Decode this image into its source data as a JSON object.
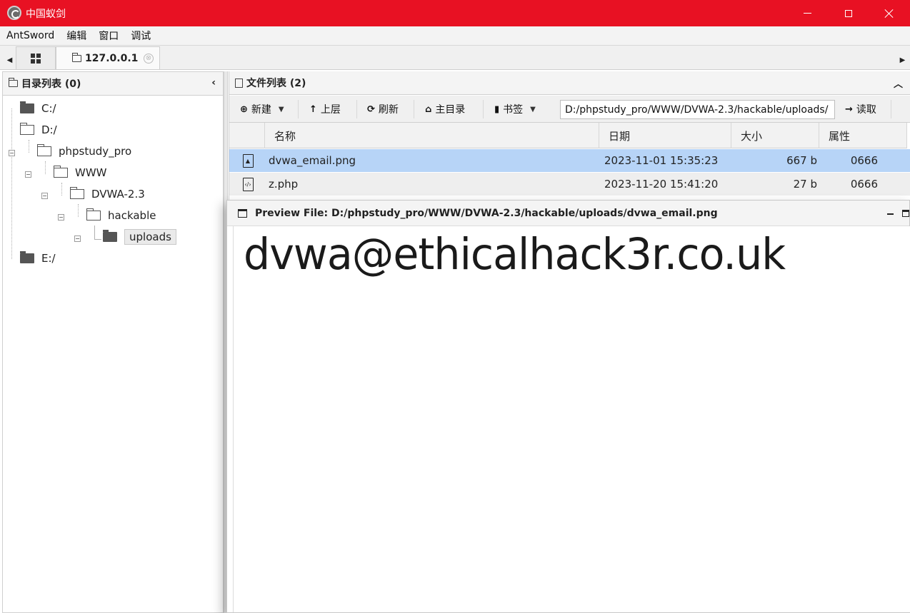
{
  "window": {
    "title": "中国蚁剑"
  },
  "menu": {
    "items": [
      "AntSword",
      "编辑",
      "窗口",
      "调试"
    ]
  },
  "tabs": {
    "host": "127.0.0.1",
    "close_glyph": "⊗"
  },
  "left_panel": {
    "title": "目录列表 (0)",
    "tree": [
      {
        "label": "C:/"
      },
      {
        "label": "D:/"
      },
      {
        "label": "phpstudy_pro"
      },
      {
        "label": "WWW"
      },
      {
        "label": "DVWA-2.3"
      },
      {
        "label": "hackable"
      },
      {
        "label": "uploads"
      },
      {
        "label": "E:/"
      }
    ]
  },
  "right_panel": {
    "title": "文件列表 (2)",
    "toolbar": {
      "new": "新建",
      "up": "上层",
      "refresh": "刷新",
      "home": "主目录",
      "bookmark": "书签",
      "path": "D:/phpstudy_pro/WWW/DVWA-2.3/hackable/uploads/",
      "read": "读取"
    },
    "columns": [
      "名称",
      "日期",
      "大小",
      "属性"
    ],
    "files": [
      {
        "name": "dvwa_email.png",
        "date": "2023-11-01 15:35:23",
        "size": "667 b",
        "attr": "0666",
        "icon": "image-file-icon"
      },
      {
        "name": "z.php",
        "date": "2023-11-20 15:41:20",
        "size": "27 b",
        "attr": "0666",
        "icon": "code-file-icon"
      }
    ]
  },
  "preview": {
    "title": "Preview File: D:/phpstudy_pro/WWW/DVWA-2.3/hackable/uploads/dvwa_email.png",
    "image_text": "dvwa@ethicalhack3r.co.uk"
  },
  "colors": {
    "titlebar": "#e81123",
    "selected_row": "#b7d4f7"
  }
}
